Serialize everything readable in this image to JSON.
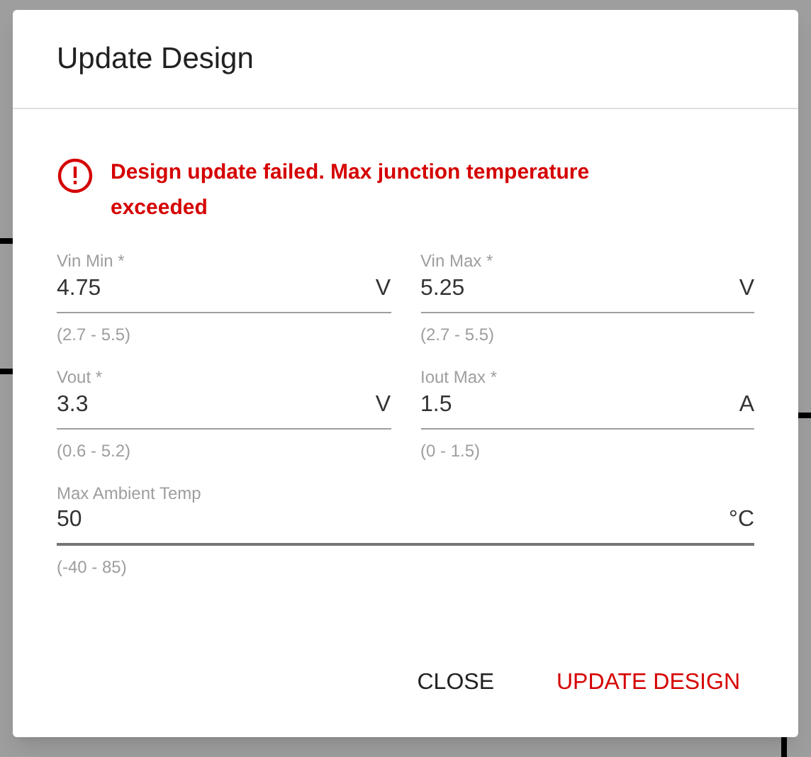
{
  "dialog": {
    "title": "Update Design",
    "error": "Design update failed. Max junction temperature exceeded",
    "fields": [
      {
        "label": "Vin Min *",
        "value": "4.75",
        "unit": "V",
        "hint": "(2.7 - 5.5)",
        "focused": false,
        "wide": false
      },
      {
        "label": "Vin Max *",
        "value": "5.25",
        "unit": "V",
        "hint": "(2.7 - 5.5)",
        "focused": false,
        "wide": false
      },
      {
        "label": "Vout *",
        "value": "3.3",
        "unit": "V",
        "hint": "(0.6 - 5.2)",
        "focused": false,
        "wide": false
      },
      {
        "label": "Iout Max *",
        "value": "1.5",
        "unit": "A",
        "hint": "(0 - 1.5)",
        "focused": false,
        "wide": false
      },
      {
        "label": "Max Ambient Temp",
        "value": "50",
        "unit": "°C",
        "hint": "(-40 - 85)",
        "focused": true,
        "wide": true
      }
    ],
    "buttons": [
      {
        "label": "CLOSE",
        "kind": "plain"
      },
      {
        "label": "UPDATE DESIGN",
        "kind": "primary"
      }
    ]
  }
}
